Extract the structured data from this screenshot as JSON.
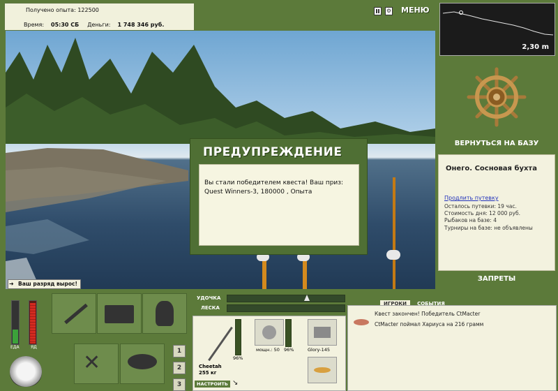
{
  "info": {
    "exp_label": "Получено опыта:",
    "exp_value": "122500",
    "time_label": "Время:",
    "time_value": "05:30 СБ",
    "money_label": "Деньги:",
    "money_value": "1 748 346 руб."
  },
  "topbar": {
    "menu_label": "МЕНЮ"
  },
  "depth": {
    "value": "2,30 m"
  },
  "right": {
    "return_label": "ВЕРНУТЬСЯ НА БАЗУ",
    "place_name": "Онего. Сосновая бухта",
    "buy_ticket": "Продлить путевку",
    "left_time": "Осталось путевки: 19 час.",
    "day_cost": "Стоимость дня: 12 000 руб.",
    "fishers": "Рыбаков на базе: 4",
    "tournaments": "Турниры на базе: не объявлены",
    "bans_label": "ЗАПРЕТЫ"
  },
  "dialog": {
    "title": "ПРЕДУПРЕЖДЕНИЕ",
    "message": "Вы стали победителем квеста! Ваш приз: Quest Winners-3, 180000 , Опыта"
  },
  "toast": "Ваш разряд вырос!",
  "gauges": {
    "food_label": "ЕДА",
    "poison_label": "ЯД"
  },
  "slots": {
    "n1": "1",
    "n2": "2",
    "n3": "3"
  },
  "tackle": {
    "rod_label": "УДОЧКА",
    "line_label": "ЛЕСКА",
    "rod_name": "Cheetah",
    "rod_weight": "255 кг",
    "rod_pct": "96%",
    "reel_power": "мощн.: 50",
    "reel_pct": "96%",
    "lure_name": "Glory-145",
    "setup_button": "НАСТРОИТЬ"
  },
  "chat": {
    "tab_players": "ИГРОКИ",
    "tab_events": "СОБЫТИЯ",
    "msg1": "Квест закончен! Победитель CtMacter",
    "msg2": "CtMacter поймал Хариуса на 216 грамм"
  },
  "colors": {
    "panel_green": "#5c7a3a",
    "panel_light": "#f3f2df",
    "food_green": "#3ca23a",
    "poison_red": "#d42a20"
  }
}
